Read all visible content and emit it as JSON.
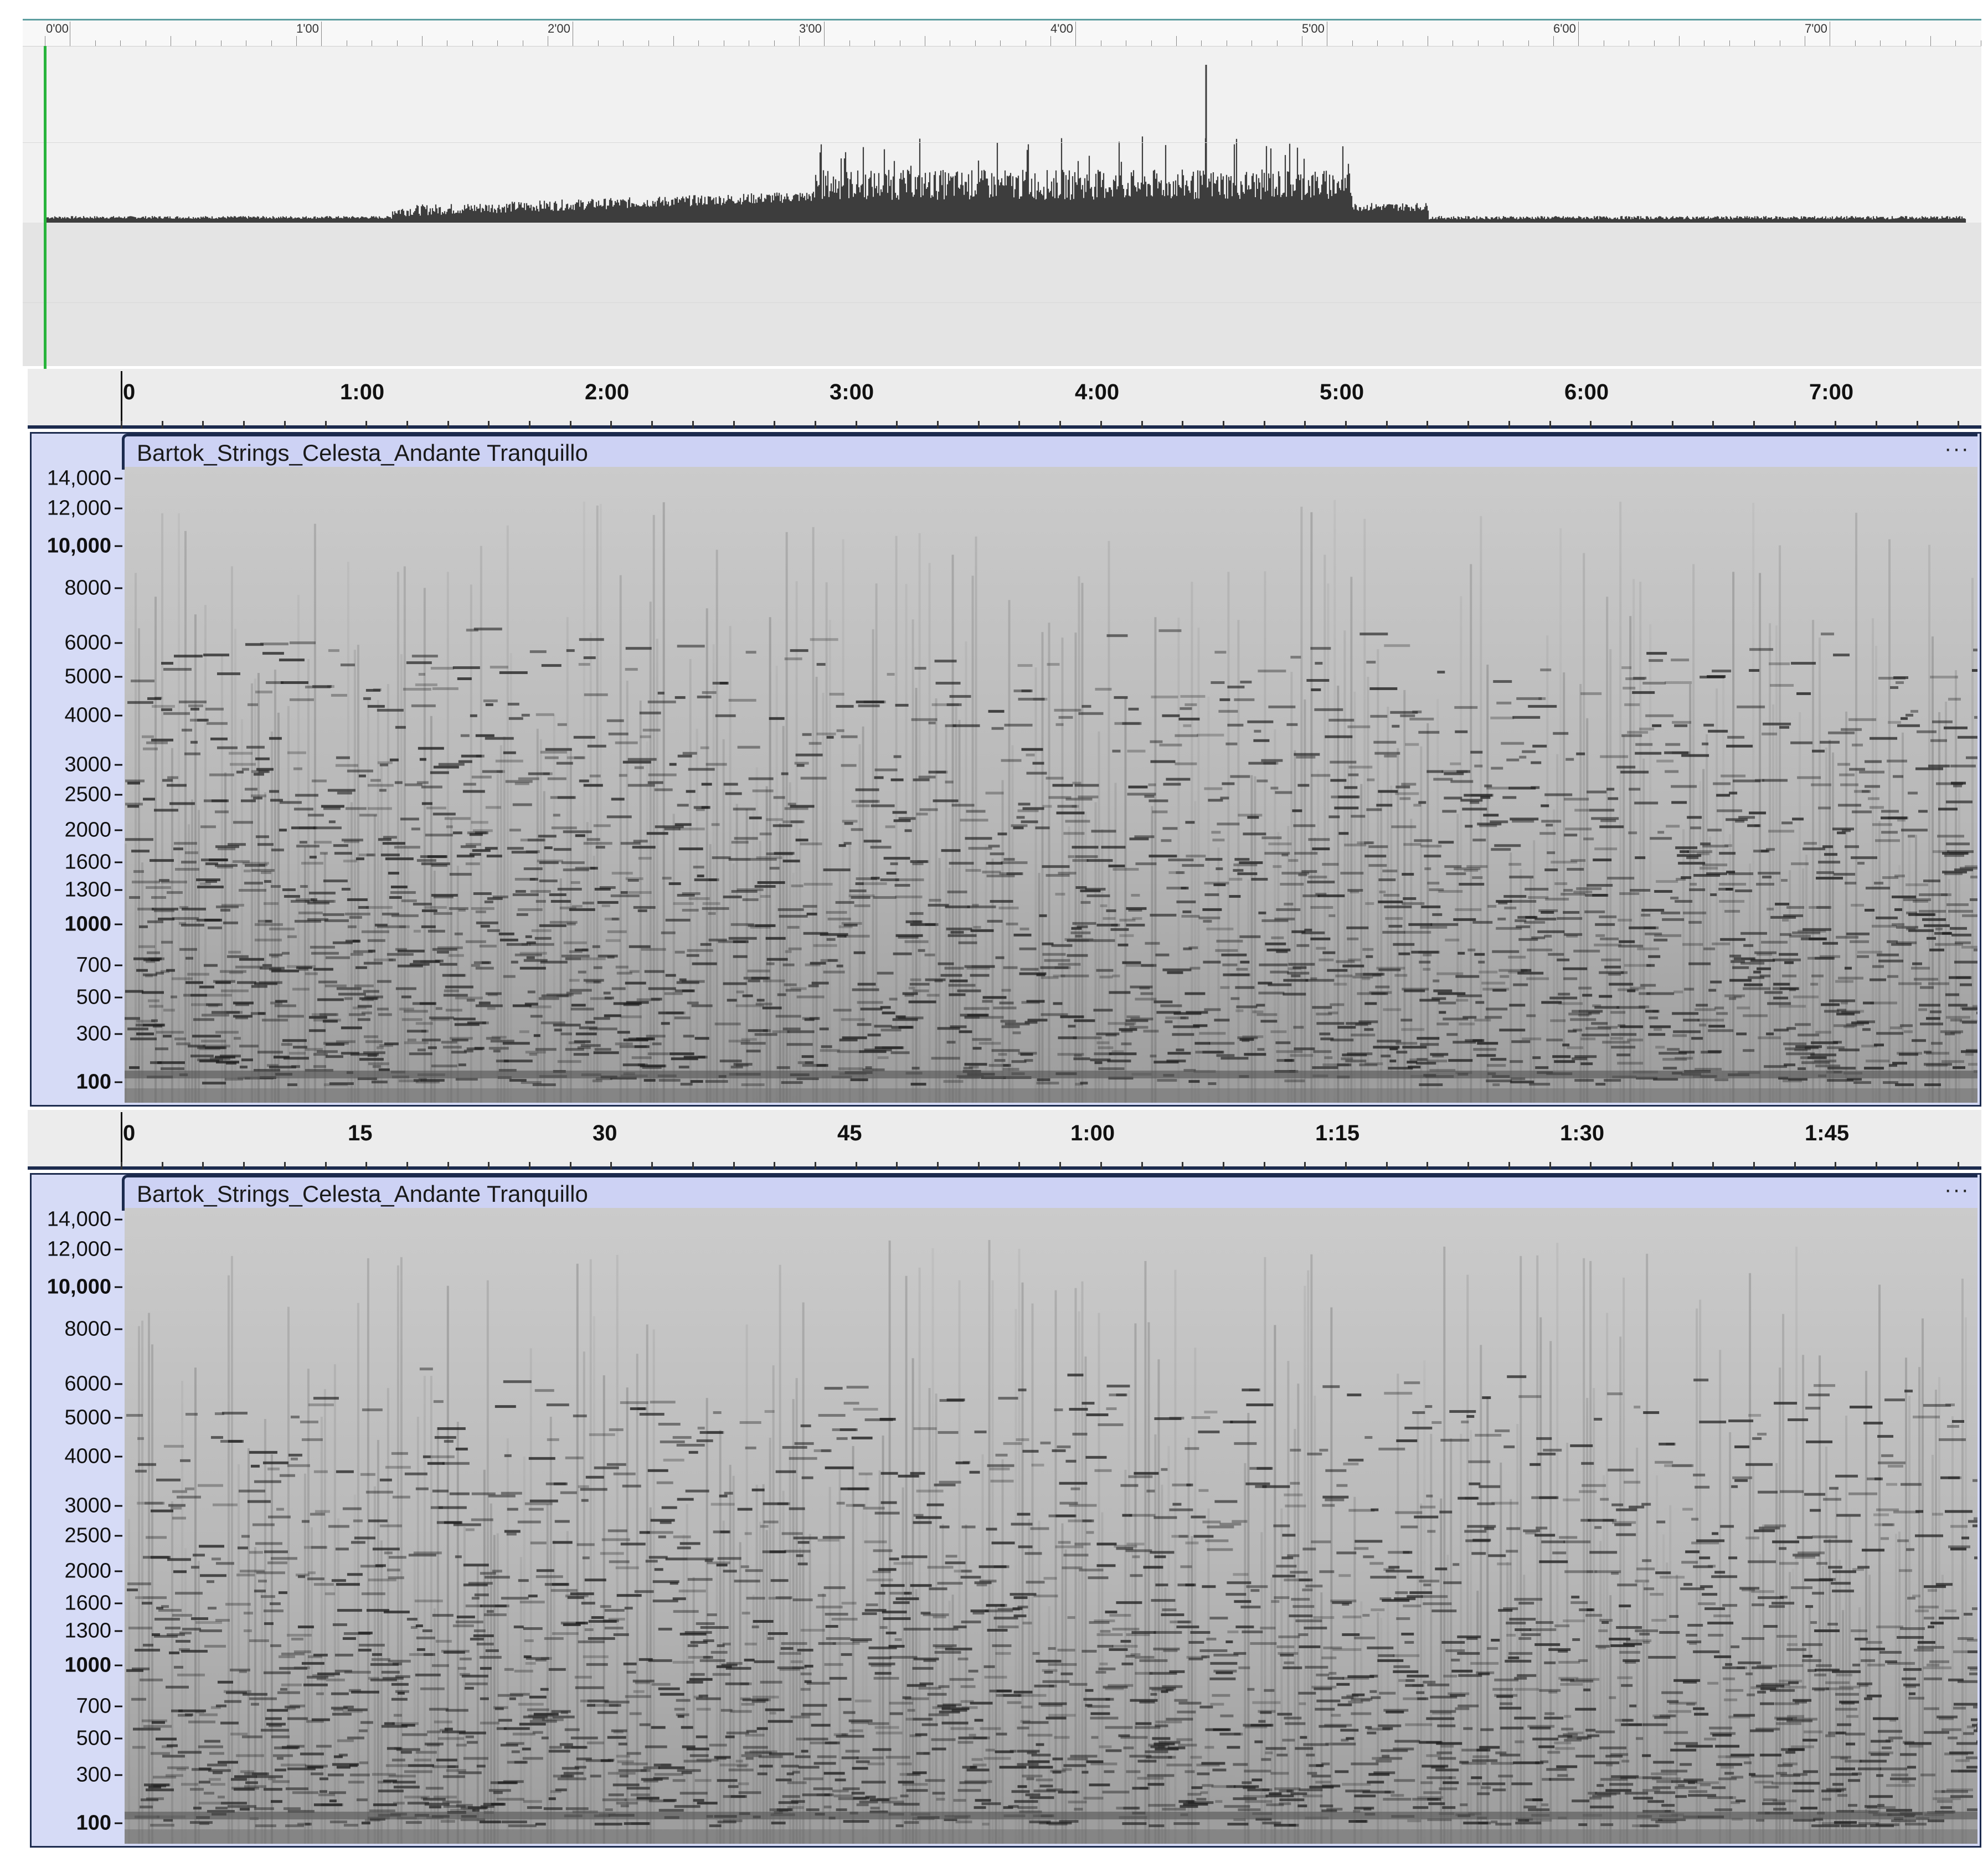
{
  "overview": {
    "ruler_labels": [
      "0'00",
      "1'00",
      "2'00",
      "3'00",
      "4'00",
      "5'00",
      "6'00",
      "7'00"
    ],
    "waveform_color": "#3d3d3d",
    "playhead_color": "#28b43c"
  },
  "ruler_top": {
    "labels": [
      "0",
      "1:00",
      "2:00",
      "3:00",
      "4:00",
      "5:00",
      "6:00",
      "7:00"
    ]
  },
  "ruler_bottom": {
    "labels": [
      "0",
      "15",
      "30",
      "45",
      "1:00",
      "1:15",
      "1:30",
      "1:45"
    ]
  },
  "tracks": [
    {
      "title": "Bartok_Strings_Celesta_Andante Tranquillo",
      "menu": "···",
      "frequency_labels": [
        "14,000",
        "12,000",
        "10,000",
        "8000",
        "6000",
        "5000",
        "4000",
        "3000",
        "2500",
        "2000",
        "1600",
        "1300",
        "1000",
        "700",
        "500",
        "300",
        "100"
      ]
    },
    {
      "title": "Bartok_Strings_Celesta_Andante Tranquillo",
      "menu": "···",
      "frequency_labels": [
        "14,000",
        "12,000",
        "10,000",
        "8000",
        "6000",
        "5000",
        "4000",
        "3000",
        "2500",
        "2000",
        "1600",
        "1300",
        "1000",
        "700",
        "500",
        "300",
        "100"
      ]
    }
  ],
  "colors": {
    "track_border": "#1c2b4e",
    "track_header": "#cdd2f4",
    "spectrogram_bg": "#c9c9c9"
  }
}
